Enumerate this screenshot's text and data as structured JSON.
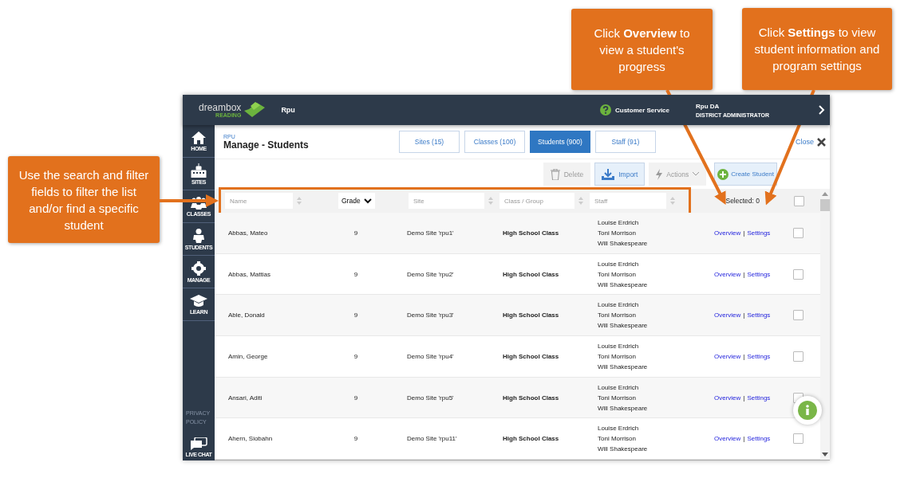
{
  "callouts": [
    {
      "kind": "left",
      "text": "Use the search and filter fields to filter the list and/or find a specific student"
    },
    {
      "kind": "overview",
      "text": "Click **Overview** to view a student's progress"
    },
    {
      "kind": "settings",
      "text": "Click **Settings** to view student information and program settings"
    }
  ],
  "topbar": {
    "logo": "dreambox",
    "logo_sub": "READING",
    "org": "Rpu",
    "help": "Customer Service",
    "user": "Rpu DA",
    "role": "DISTRICT ADMINISTRATOR"
  },
  "sidebar": {
    "items": [
      {
        "kind": "home",
        "label": "HOME"
      },
      {
        "kind": "sites",
        "label": "SITES"
      },
      {
        "kind": "classes",
        "label": "CLASSES"
      },
      {
        "kind": "students",
        "label": "STUDENTS"
      },
      {
        "kind": "manage",
        "label": "MANAGE"
      },
      {
        "kind": "learn",
        "label": "LEARN"
      }
    ],
    "privacy": "PRIVACY POLICY",
    "chat": "LIVE CHAT"
  },
  "header": {
    "breadcrumb": "RPU",
    "title": "Manage - Students",
    "close": "Close",
    "tabs": [
      {
        "label": "Sites (15)",
        "selected": false
      },
      {
        "label": "Classes (100)",
        "selected": false
      },
      {
        "label": "Students (900)",
        "selected": true
      },
      {
        "label": "Staff (91)",
        "selected": false
      }
    ]
  },
  "toolbar": [
    {
      "kind": "delete",
      "label": "Delete",
      "disabled": true
    },
    {
      "kind": "import",
      "label": "Import",
      "disabled": false
    },
    {
      "kind": "actions",
      "label": "Actions",
      "disabled": true
    },
    {
      "kind": "create",
      "label": "Create Student",
      "disabled": false
    }
  ],
  "filters": {
    "name": {
      "placeholder": "Name"
    },
    "grade": "Grade",
    "site": {
      "placeholder": "Site"
    },
    "class": {
      "placeholder": "Class / Group"
    },
    "staff": {
      "placeholder": "Staff"
    },
    "selected": "Selected: 0",
    "all_checked": false
  },
  "rows": [
    {
      "name": "Abbas, Mateo",
      "grade": "9",
      "site": "Demo Site 'rpu1'",
      "class": "High School Class",
      "staff": [
        "Louise Erdrich",
        "Toni Morrison",
        "Will Shakespeare"
      ],
      "overview": "Overview",
      "separator": "|",
      "settings": "Settings",
      "checked": false
    },
    {
      "name": "Abbas, Mattias",
      "grade": "9",
      "site": "Demo Site 'rpu2'",
      "class": "High School Class",
      "staff": [
        "Louise Erdrich",
        "Toni Morrison",
        "Will Shakespeare"
      ],
      "overview": "Overview",
      "separator": "|",
      "settings": "Settings",
      "checked": false
    },
    {
      "name": "Able, Donald",
      "grade": "9",
      "site": "Demo Site 'rpu3'",
      "class": "High School Class",
      "staff": [
        "Louise Erdrich",
        "Toni Morrison",
        "Will Shakespeare"
      ],
      "overview": "Overview",
      "separator": "|",
      "settings": "Settings",
      "checked": false
    },
    {
      "name": "Amin, George",
      "grade": "9",
      "site": "Demo Site 'rpu4'",
      "class": "High School Class",
      "staff": [
        "Louise Erdrich",
        "Toni Morrison",
        "Will Shakespeare"
      ],
      "overview": "Overview",
      "separator": "|",
      "settings": "Settings",
      "checked": false
    },
    {
      "name": "Ansari, Aditi",
      "grade": "9",
      "site": "Demo Site 'rpu5'",
      "class": "High School Class",
      "staff": [
        "Louise Erdrich",
        "Toni Morrison",
        "Will Shakespeare"
      ],
      "overview": "Overview",
      "separator": "|",
      "settings": "Settings",
      "checked": false
    },
    {
      "name": "Ahern, Siobahn",
      "grade": "9",
      "site": "Demo Site 'rpu11'",
      "class": "High School Class",
      "staff": [
        "Louise Erdrich",
        "Toni Morrison",
        "Will Shakespeare"
      ],
      "overview": "Overview",
      "separator": "|",
      "settings": "Settings",
      "checked": false
    }
  ]
}
